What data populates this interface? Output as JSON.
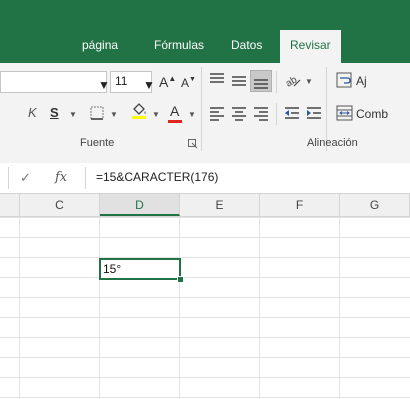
{
  "ribbon_tabs": [
    {
      "label": "página",
      "active": false
    },
    {
      "label": "Fórmulas",
      "active": false
    },
    {
      "label": "Datos",
      "active": false
    },
    {
      "label": "Revisar",
      "active": true
    }
  ],
  "font_group": {
    "font_size": "11",
    "grow_font": "A",
    "shrink_font": "A",
    "strikethrough_label": "S",
    "font_color_label": "A",
    "label": "Fuente"
  },
  "alignment_group": {
    "wrap_label": "Aj",
    "merge_label": "Comb",
    "label": "Alineación"
  },
  "formula_bar": {
    "fx_label": "fx",
    "formula": "=15&CARACTER(176)"
  },
  "sheet": {
    "columns": [
      "C",
      "D",
      "E",
      "F",
      "G"
    ],
    "selected_column": "D",
    "active_cell_value": "15°"
  },
  "colors": {
    "accent": "#217346",
    "highlight_yellow": "#ffff00",
    "font_red": "#e0251b"
  }
}
